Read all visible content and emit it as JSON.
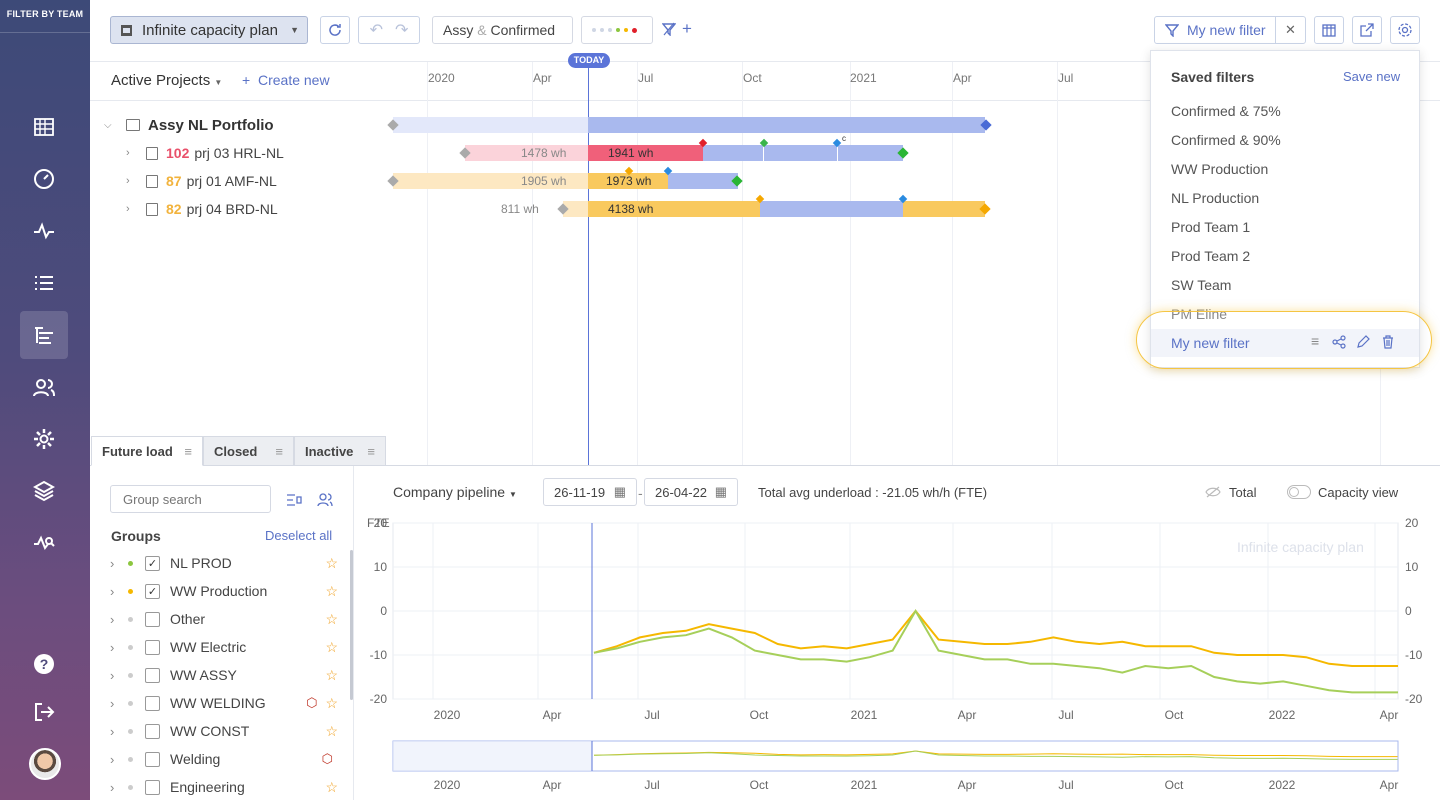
{
  "sidebar": {
    "title": "FILTER BY TEAM",
    "icons": [
      "grid-icon",
      "dashboard-icon",
      "pulse-icon",
      "list-icon",
      "tree-list-icon",
      "users-icon",
      "gear-icon",
      "layers-icon",
      "analytics-icon",
      "help-icon",
      "logout-icon",
      "avatar"
    ]
  },
  "toolbar": {
    "plan": "Infinite capacity plan",
    "filter_chip_1": "Assy",
    "filter_chip_amp": "&",
    "filter_chip_2": "Confirmed",
    "active_filter": "My new filter"
  },
  "timeline": {
    "header": "Active Projects",
    "create": "Create new",
    "today": "TODAY",
    "ticks": [
      "2020",
      "Apr",
      "Jul",
      "Oct",
      "2021",
      "Apr",
      "Jul"
    ],
    "portfolio": "Assy NL Portfolio",
    "projects": [
      {
        "prio": "102",
        "name": "prj 03 HRL-NL",
        "past": "1478 wh",
        "future": "1941 wh",
        "prio_color": "#e9506a"
      },
      {
        "prio": "87",
        "name": "prj 01 AMF-NL",
        "past": "1905 wh",
        "future": "1973 wh",
        "prio_color": "#f2b33d"
      },
      {
        "prio": "82",
        "name": "prj 04 BRD-NL",
        "past": "811 wh",
        "future": "4138 wh",
        "prio_color": "#f2b33d"
      }
    ],
    "marker_c": "c"
  },
  "saved_filters": {
    "title": "Saved filters",
    "save_new": "Save new",
    "items": [
      "Confirmed & 75%",
      "Confirmed & 90%",
      "WW Production",
      "NL Production",
      "Prod Team 1",
      "Prod Team 2",
      "SW Team",
      "PM Eline",
      "My new filter"
    ]
  },
  "tabs": [
    "Future load",
    "Closed",
    "Inactive"
  ],
  "groups": {
    "search_placeholder": "Group search",
    "title": "Groups",
    "deselect": "Deselect all",
    "items": [
      {
        "name": "NL PROD",
        "checked": "✓",
        "dot": "#8cc63f"
      },
      {
        "name": "WW Production",
        "checked": "✓",
        "dot": "#f5b800"
      },
      {
        "name": "Other",
        "checked": "",
        "dot": "#ccc"
      },
      {
        "name": "WW Electric",
        "checked": "",
        "dot": "#ccc"
      },
      {
        "name": "WW ASSY",
        "checked": "",
        "dot": "#ccc"
      },
      {
        "name": "WW WELDING",
        "checked": "",
        "dot": "#ccc"
      },
      {
        "name": "WW CONST",
        "checked": "",
        "dot": "#ccc"
      },
      {
        "name": "Welding",
        "checked": "",
        "dot": "#ccc"
      },
      {
        "name": "Engineering",
        "checked": "",
        "dot": "#ccc"
      }
    ]
  },
  "chart_panel": {
    "pipeline": "Company pipeline",
    "date_from": "26-11-19",
    "date_sep": "-",
    "date_to": "26-04-22",
    "summary": "Total avg underload : -21.05 wh/h (FTE)",
    "total": "Total",
    "capacity_view": "Capacity view",
    "watermark": "Infinite capacity plan",
    "ylabel": "FTE"
  },
  "chart_data": {
    "type": "line",
    "ylabel": "FTE",
    "ylim": [
      -20,
      20
    ],
    "yticks": [
      "20",
      "10",
      "0",
      "-10",
      "-20"
    ],
    "xticks": [
      "2020",
      "Apr",
      "Jul",
      "Oct",
      "2021",
      "Apr",
      "Jul",
      "Oct",
      "2022",
      "Apr"
    ],
    "series": [
      {
        "color": "#f5b800",
        "values": [
          -9.5,
          -8,
          -6,
          -5,
          -4.5,
          -3,
          -4,
          -5,
          -7.5,
          -8.5,
          -8,
          -8.5,
          -7.5,
          -6.5,
          0,
          -6.5,
          -7,
          -7.5,
          -7.5,
          -7,
          -6,
          -7,
          -7.5,
          -7,
          -8,
          -8,
          -8,
          -9.5,
          -10,
          -10,
          -10,
          -10.5,
          -12,
          -12.5,
          -12.5,
          -12.5
        ]
      },
      {
        "color": "#a6cf5a",
        "values": [
          -9.5,
          -8.5,
          -7,
          -6,
          -5.5,
          -4,
          -6,
          -9,
          -10,
          -11,
          -11,
          -11.5,
          -10.5,
          -9,
          0,
          -9,
          -10,
          -11,
          -11,
          -12,
          -12,
          -12.5,
          -13,
          -14,
          -12.5,
          -13,
          -12.5,
          -15,
          -16,
          -16.5,
          -16,
          -17,
          -18,
          -18.5,
          -18.5,
          -18.5
        ]
      }
    ]
  }
}
